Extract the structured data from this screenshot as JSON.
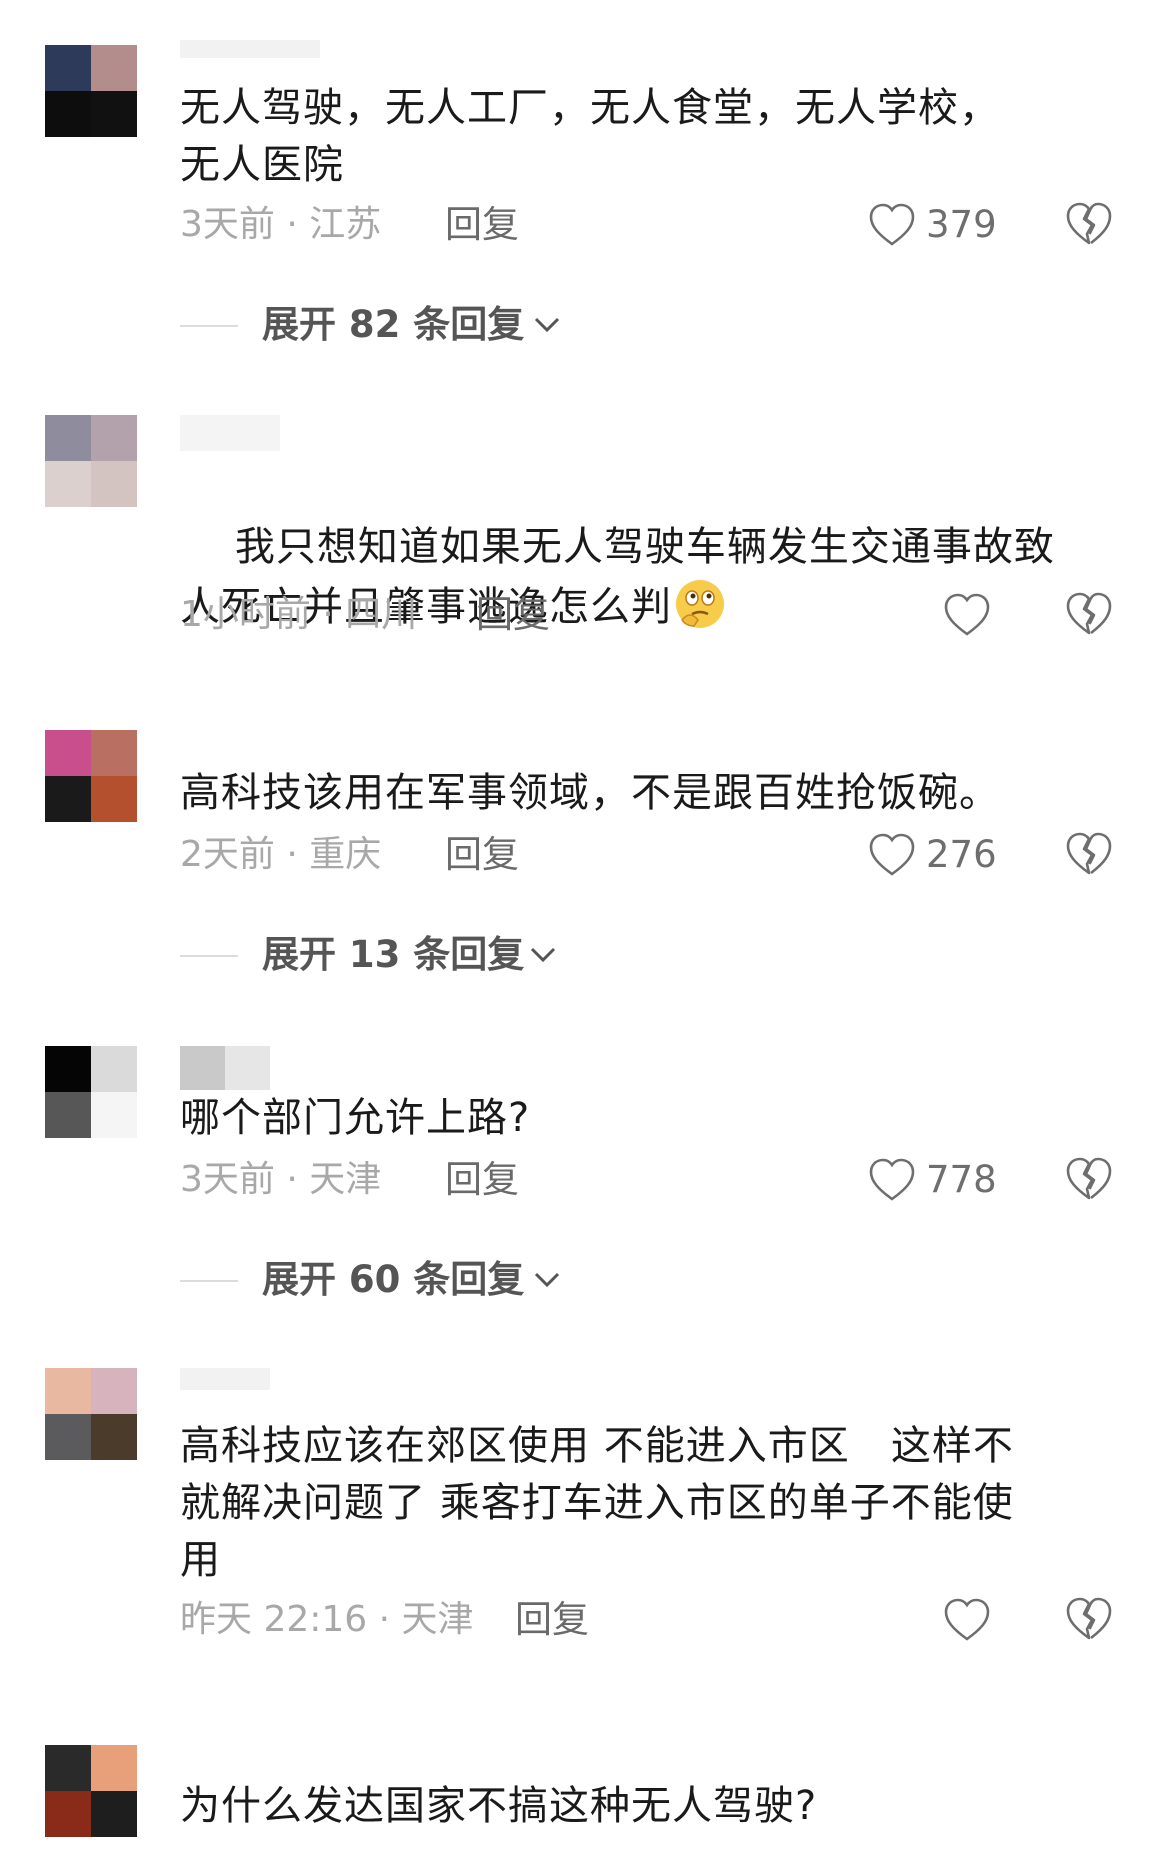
{
  "comments": [
    {
      "text": "无人驾驶，无人工厂，无人食堂，无人学校，\n无人医院",
      "time_location": "3天前 · 江苏",
      "reply_label": "回复",
      "likes": "379",
      "expand_label": "展开 82 条回复"
    },
    {
      "text": "我只想知道如果无人驾驶车辆发生交通事故致\n人死亡并且肇事逃逸怎么判",
      "time_location": "1小时前 · 四川",
      "reply_label": "回复",
      "likes": ""
    },
    {
      "text": "高科技该用在军事领域，不是跟百姓抢饭碗。",
      "time_location": "2天前 · 重庆",
      "reply_label": "回复",
      "likes": "276",
      "expand_label": "展开 13 条回复"
    },
    {
      "text": "哪个部门允许上路?",
      "time_location": "3天前 · 天津",
      "reply_label": "回复",
      "likes": "778",
      "expand_label": "展开 60 条回复"
    },
    {
      "text": "高科技应该在郊区使用 不能进入市区   这样不\n就解决问题了 乘客打车进入市区的单子不能使\n用",
      "time_location": "昨天 22:16 · 天津",
      "reply_label": "回复",
      "likes": ""
    },
    {
      "text": "为什么发达国家不搞这种无人驾驶?"
    }
  ],
  "colors": {
    "text": "#1a1a1a",
    "meta": "#a8a8a8",
    "icon": "#6e6e6e"
  },
  "icons": {
    "like": "heart-outline-icon",
    "dislike": "broken-heart-icon",
    "expand": "chevron-down-icon",
    "emoji": "thinking-face-emoji"
  }
}
